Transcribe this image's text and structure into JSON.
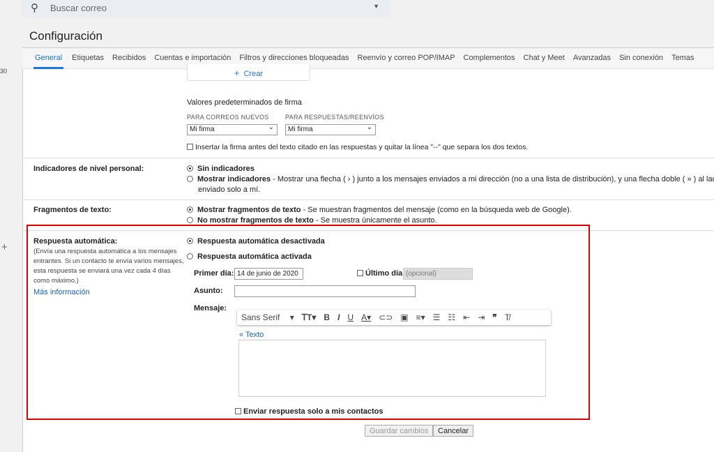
{
  "search": {
    "placeholder": "Buscar correo",
    "icon": "search-icon"
  },
  "left": {
    "count": "30",
    "plus": "+"
  },
  "title": "Configuración",
  "tabs": [
    "General",
    "Etiquetas",
    "Recibidos",
    "Cuentas e importación",
    "Filtros y direcciones bloqueadas",
    "Reenvío y correo POP/IMAP",
    "Complementos",
    "Chat y Meet",
    "Avanzadas",
    "Sin conexión",
    "Temas"
  ],
  "signature": {
    "create": "Crear",
    "defaults_title": "Valores predeterminados de firma",
    "new_label": "PARA CORREOS NUEVOS",
    "reply_label": "PARA RESPUESTAS/REENVÍOS",
    "new_value": "Mi firma",
    "reply_value": "Mi firma",
    "insert_before": "Insertar la firma antes del texto citado en las respuestas y quitar la línea \"--\" que separa los dos textos."
  },
  "indicators": {
    "label": "Indicadores de nivel personal:",
    "opt1": "Sin indicadores",
    "opt2": "Mostrar indicadores",
    "opt2_desc": " - Mostrar una flecha ( › ) junto a los mensajes enviados a mi dirección (no a una lista de distribución), y una flecha doble ( » ) al lado de los",
    "opt2_desc2": "enviado solo a mí."
  },
  "snippets": {
    "label": "Fragmentos de texto:",
    "opt1": "Mostrar fragmentos de texto",
    "opt1_desc": " - Se muestran fragmentos del mensaje (como en la búsqueda web de Google).",
    "opt2": "No mostrar fragmentos de texto",
    "opt2_desc": " - Se muestra únicamente el asunto."
  },
  "autoreply": {
    "label": "Respuesta automática:",
    "desc": "(Envía una respuesta automática a los mensajes entrantes. Si un contacto te envía varios mensajes, esta respuesta se enviará una vez cada 4 días como máximo.)",
    "more": "Más información",
    "off": "Respuesta automática desactivada",
    "on": "Respuesta automática activada",
    "first_day_label": "Primer día:",
    "first_day_value": "14 de junio de 2020",
    "last_day_label": "Último día:",
    "last_day_placeholder": "(opcional)",
    "subject_label": "Asunto:",
    "subject_value": "",
    "message_label": "Mensaje:",
    "font": "Sans Serif",
    "plain_text": "« Texto",
    "contacts_only": "Enviar respuesta solo a mis contactos",
    "highlight_color": "#e00000"
  },
  "actions": {
    "save": "Guardar cambios",
    "cancel": "Cancelar"
  }
}
